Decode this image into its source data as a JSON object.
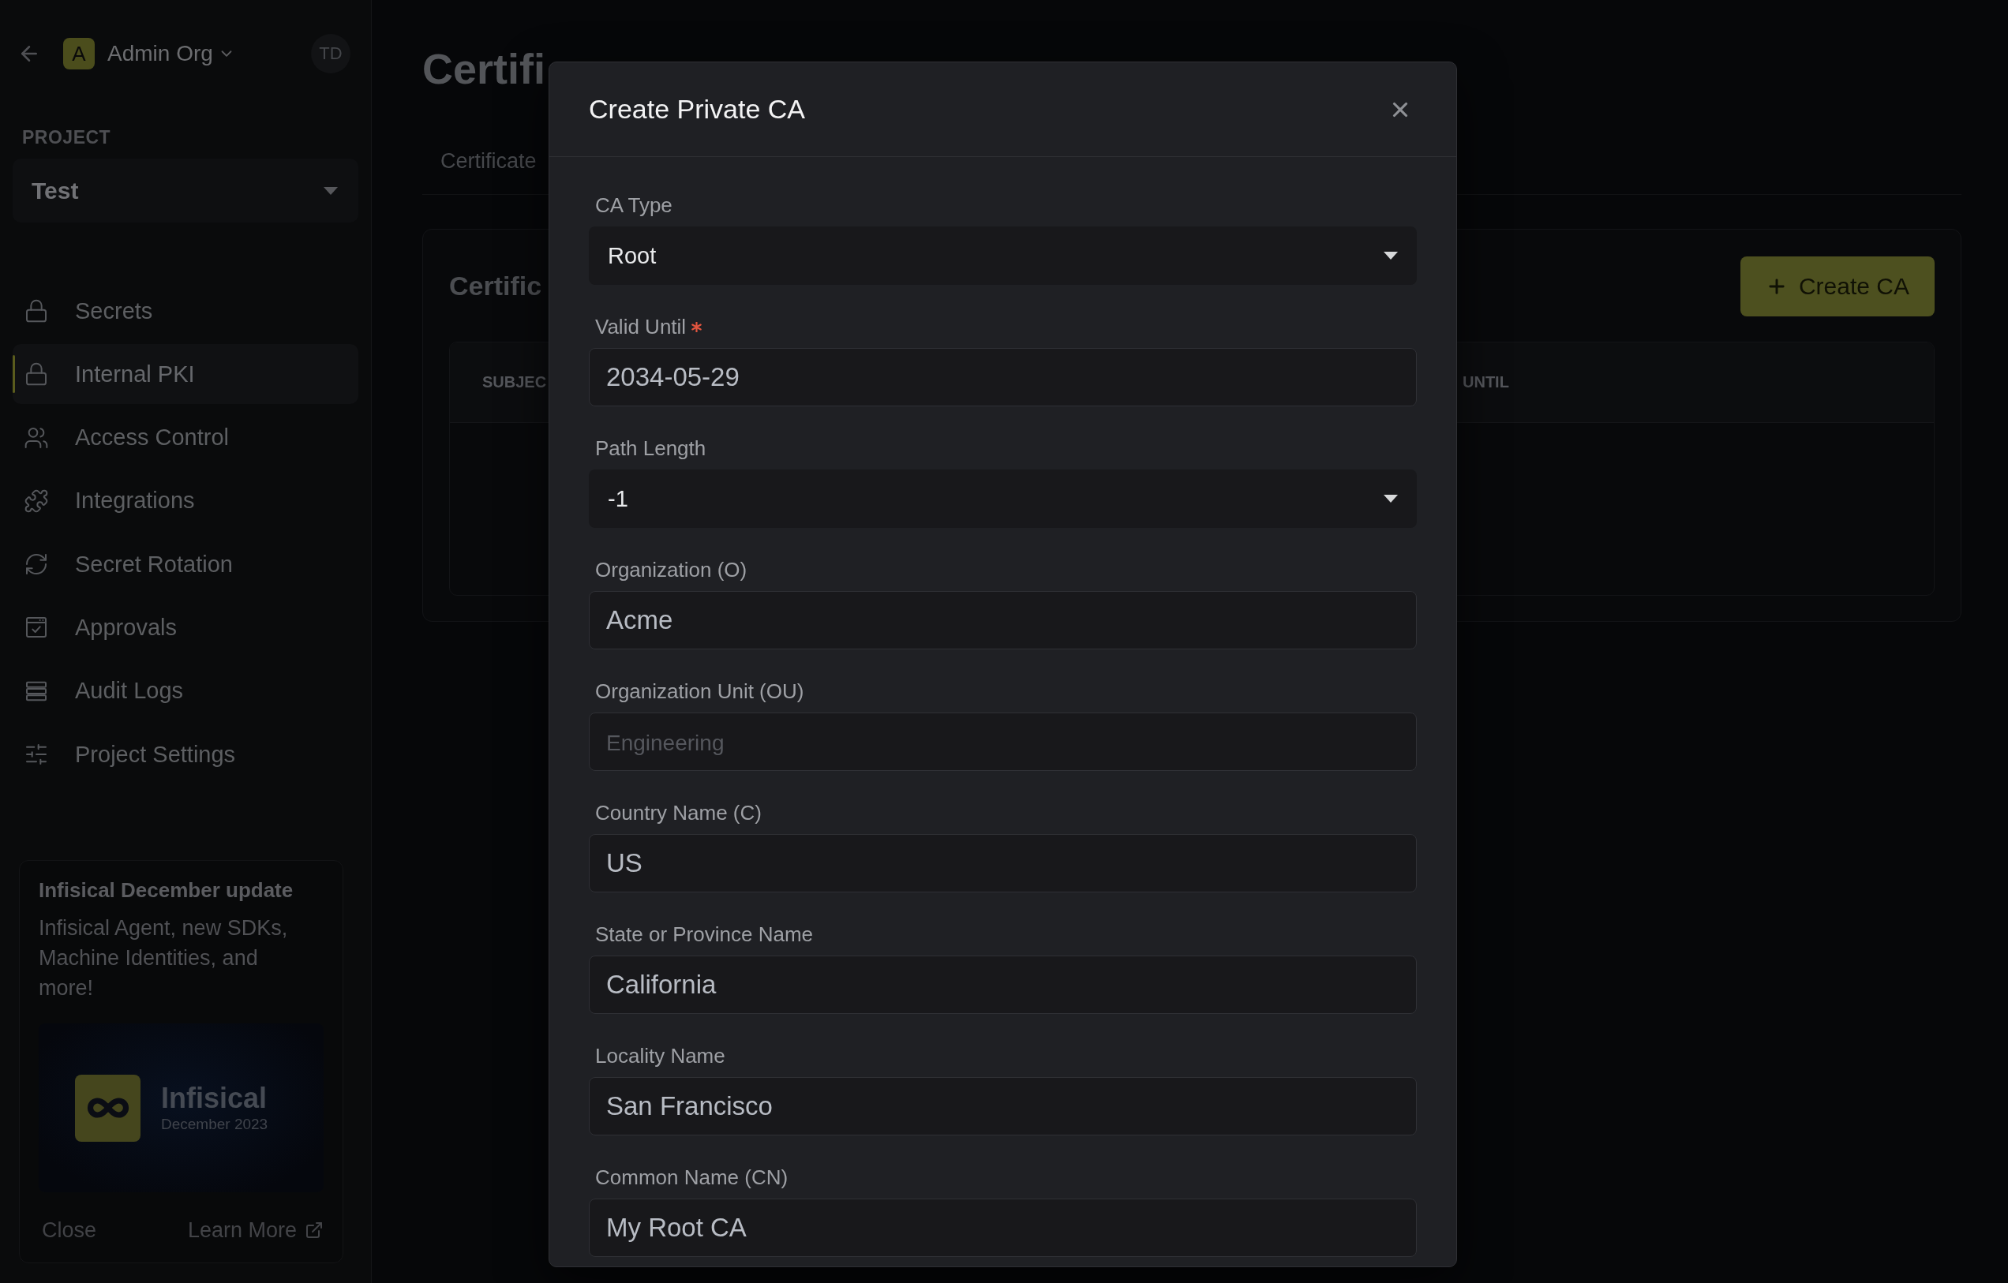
{
  "sidebar": {
    "org": {
      "initial": "A",
      "name": "Admin Org"
    },
    "user": {
      "initials": "TD"
    },
    "project": {
      "label": "PROJECT",
      "value": "Test"
    },
    "nav_items": [
      {
        "label": "Secrets",
        "selected": false
      },
      {
        "label": "Internal PKI",
        "selected": true
      },
      {
        "label": "Access Control",
        "selected": false
      },
      {
        "label": "Integrations",
        "selected": false
      },
      {
        "label": "Secret Rotation",
        "selected": false
      },
      {
        "label": "Approvals",
        "selected": false
      },
      {
        "label": "Audit Logs",
        "selected": false
      },
      {
        "label": "Project Settings",
        "selected": false
      }
    ],
    "update_card": {
      "title": "Infisical December update",
      "text": "Infisical Agent, new SDKs, Machine Identities, and more!",
      "banner": {
        "title": "Infisical",
        "subtitle": "December 2023"
      },
      "close": "Close",
      "learn_more": "Learn More"
    }
  },
  "main": {
    "title": "Certifi",
    "tabs": [
      {
        "label": "Certificate"
      }
    ],
    "panel": {
      "title": "Certific",
      "create_button": "Create CA",
      "table": {
        "columns": [
          "SUBJEC",
          "UNTIL"
        ]
      }
    }
  },
  "modal": {
    "title": "Create Private CA",
    "fields": [
      {
        "kind": "select",
        "label": "CA Type",
        "value": "Root",
        "required": false
      },
      {
        "kind": "input",
        "label": "Valid Until",
        "value": "2034-05-29",
        "required": true
      },
      {
        "kind": "select",
        "label": "Path Length",
        "value": "-1",
        "required": false
      },
      {
        "kind": "input",
        "label": "Organization (O)",
        "value": "Acme",
        "required": false
      },
      {
        "kind": "input",
        "label": "Organization Unit (OU)",
        "placeholder": "Engineering",
        "required": false
      },
      {
        "kind": "input",
        "label": "Country Name (C)",
        "value": "US",
        "required": false
      },
      {
        "kind": "input",
        "label": "State or Province Name",
        "value": "California",
        "required": false
      },
      {
        "kind": "input",
        "label": "Locality Name",
        "value": "San Francisco",
        "required": false
      },
      {
        "kind": "input",
        "label": "Common Name (CN)",
        "value": "My Root CA",
        "required": false
      }
    ]
  }
}
